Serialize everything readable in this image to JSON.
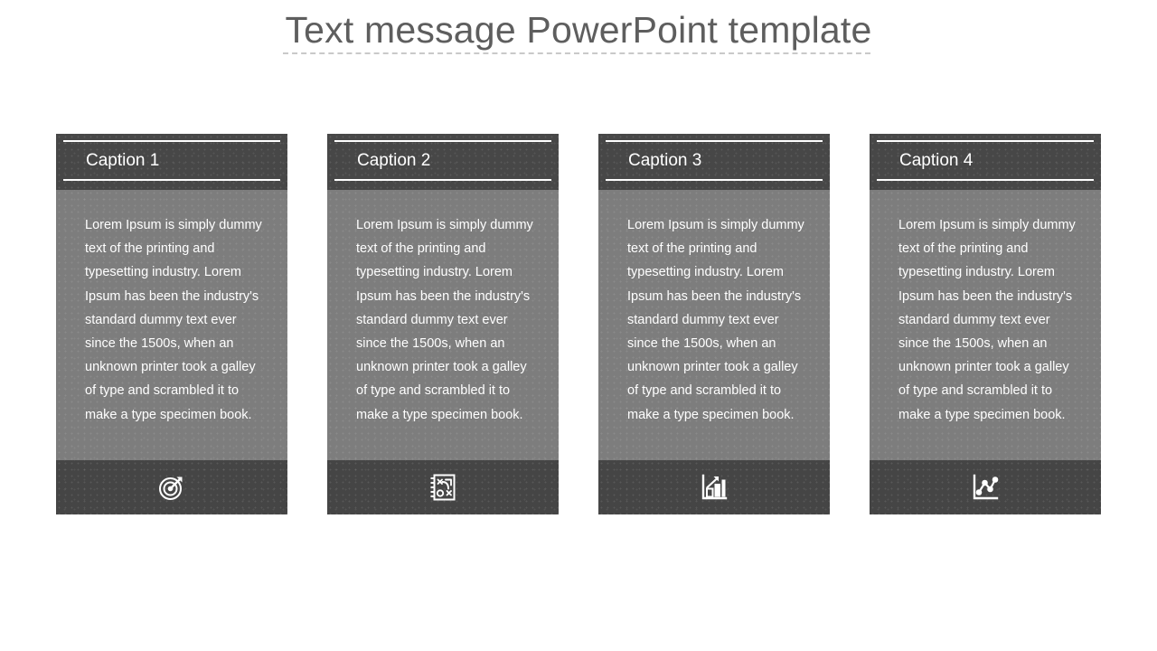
{
  "slide": {
    "title": "Text message PowerPoint template",
    "background_color": "#ffffff",
    "title_color": "#5e5e5e",
    "divider_style": "dashed",
    "divider_color": "#c9c9c9"
  },
  "theme": {
    "header_color": "#474747",
    "body_color": "#7d7d7d",
    "footer_color": "#454545",
    "text_color": "#ffffff"
  },
  "cards": [
    {
      "caption": "Caption 1",
      "body": "Lorem Ipsum is simply dummy text of the printing and typesetting industry. Lorem Ipsum has been the industry's standard dummy text ever since the 1500s, when an unknown printer took a galley of type and scrambled it to make a type specimen book.",
      "icon": "target-arrow-icon"
    },
    {
      "caption": "Caption 2",
      "body": "Lorem Ipsum is simply dummy text of the printing and typesetting industry. Lorem Ipsum has been the industry's standard dummy text ever since the 1500s, when an unknown printer took a galley of type and scrambled it to make a type specimen book.",
      "icon": "strategy-playbook-icon"
    },
    {
      "caption": "Caption 3",
      "body": "Lorem Ipsum is simply dummy text of the printing and typesetting industry. Lorem Ipsum has been the industry's standard dummy text ever since the 1500s, when an unknown printer took a galley of type and scrambled it to make a type specimen book.",
      "icon": "bar-chart-growth-icon"
    },
    {
      "caption": "Caption 4",
      "body": "Lorem Ipsum is simply dummy text of the printing and typesetting industry. Lorem Ipsum has been the industry's standard dummy text ever since the 1500s, when an unknown printer took a galley of type and scrambled it to make a type specimen book.",
      "icon": "line-chart-points-icon"
    }
  ]
}
